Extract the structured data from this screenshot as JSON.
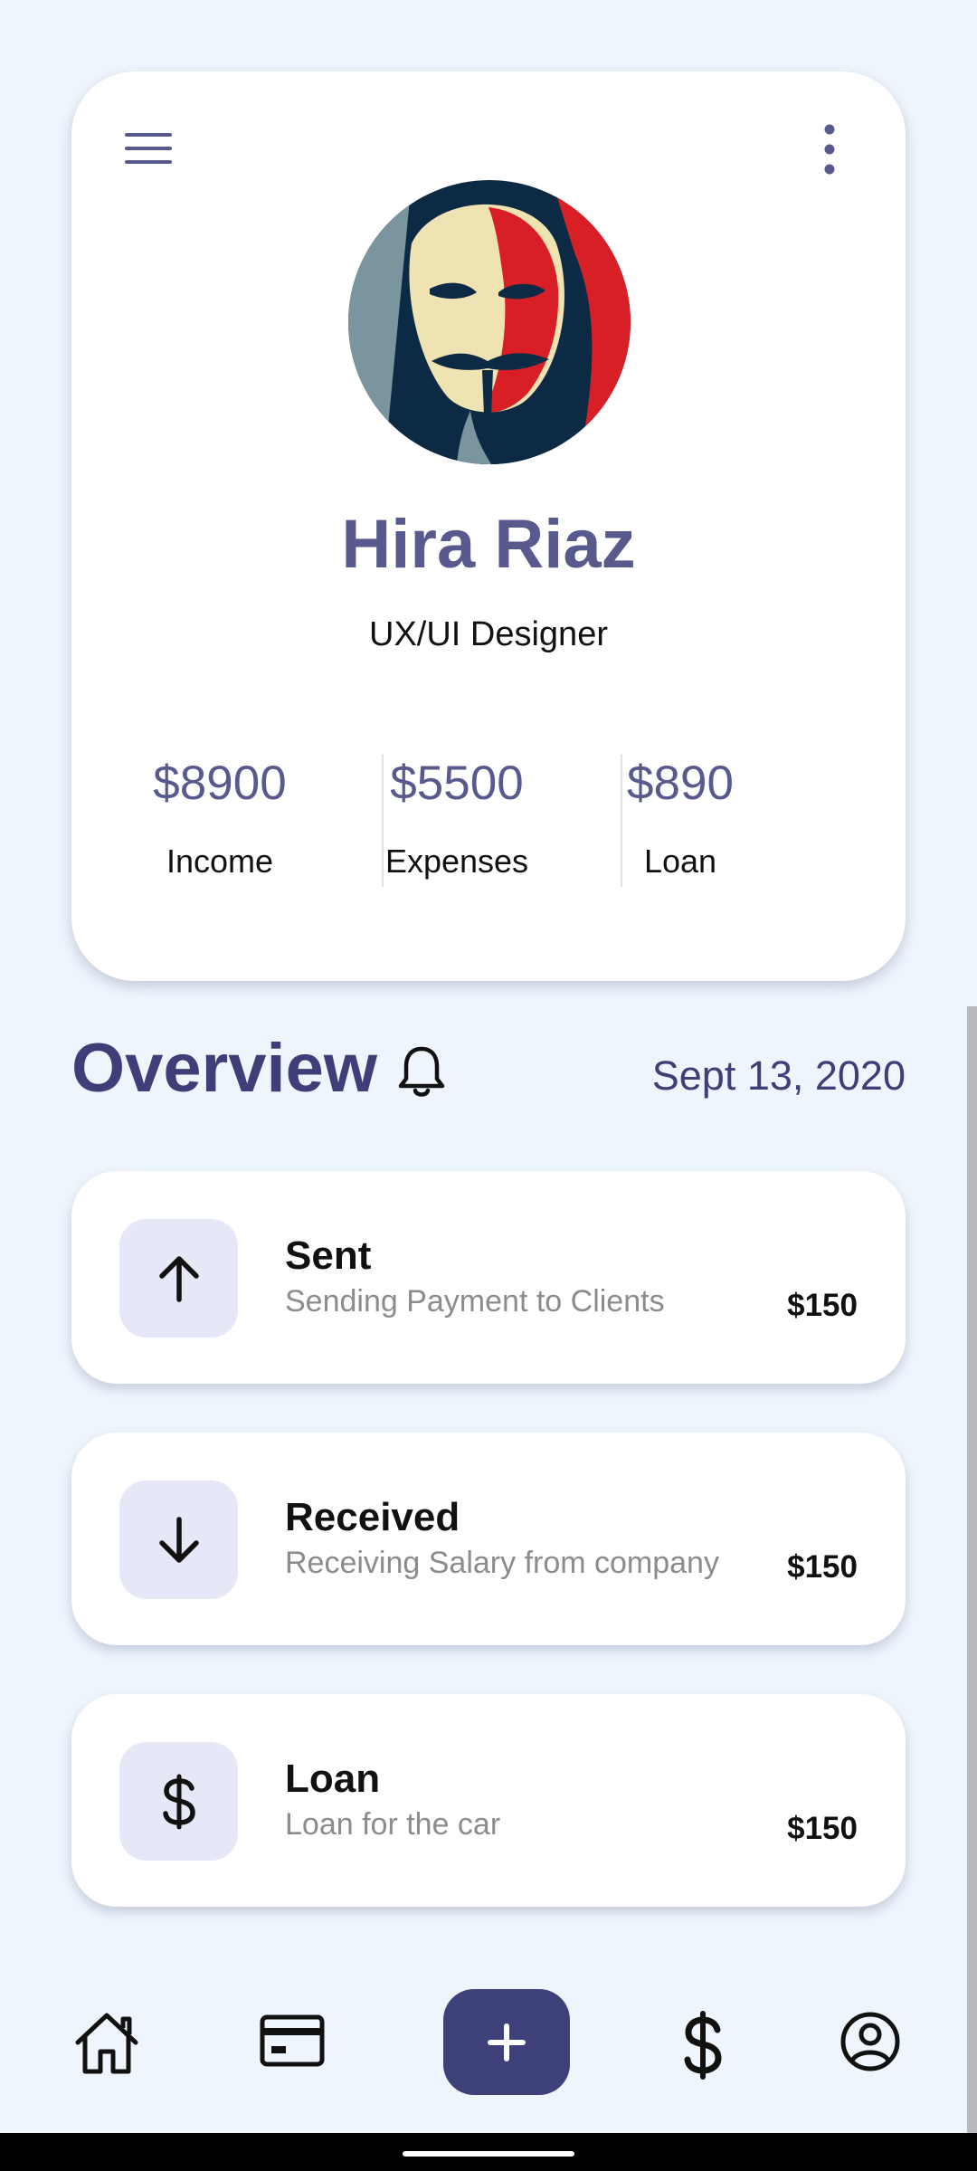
{
  "profile": {
    "name": "Hira Riaz",
    "role": "UX/UI Designer",
    "stats": [
      {
        "value": "$8900",
        "label": "Income"
      },
      {
        "value": "$5500",
        "label": "Expenses"
      },
      {
        "value": "$890",
        "label": "Loan"
      }
    ]
  },
  "overview": {
    "title": "Overview",
    "date": "Sept 13, 2020"
  },
  "transactions": [
    {
      "title": "Sent",
      "subtitle": "Sending Payment to Clients",
      "amount": "$150",
      "icon": "arrow-up-icon"
    },
    {
      "title": "Received",
      "subtitle": "Receiving Salary from company",
      "amount": "$150",
      "icon": "arrow-down-icon"
    },
    {
      "title": "Loan",
      "subtitle": "Loan for the car",
      "amount": "$150",
      "icon": "dollar-icon"
    }
  ],
  "nav": {
    "items": [
      "home-icon",
      "card-icon",
      "plus-icon",
      "dollar-icon",
      "profile-icon"
    ]
  },
  "colors": {
    "accent": "#3d4079",
    "name": "#585a8e",
    "background": "#eef5fd",
    "icon_box": "#e6e7f7"
  }
}
